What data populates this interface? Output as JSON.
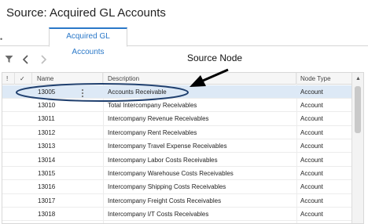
{
  "header": {
    "title": "Source: Acquired GL Accounts"
  },
  "tabs": [
    {
      "label": "Acquired GL Accounts",
      "active": true
    }
  ],
  "toolbar": {
    "icons": [
      "filter-icon",
      "back-arrow-icon",
      "forward-arrow-icon"
    ]
  },
  "annotation": {
    "label": "Source Node"
  },
  "grid": {
    "columns": [
      "!",
      "✓",
      "Name",
      "Description",
      "Node Type"
    ],
    "rows": [
      {
        "name": "13005",
        "description": "Accounts Receivable",
        "node_type": "Account",
        "selected": true
      },
      {
        "name": "13010",
        "description": "Total Intercompany Receivables",
        "node_type": "Account"
      },
      {
        "name": "13011",
        "description": "Intercompany Revenue Receivables",
        "node_type": "Account"
      },
      {
        "name": "13012",
        "description": "Intercompany Rent Receivables",
        "node_type": "Account"
      },
      {
        "name": "13013",
        "description": "Intercompany Travel Expense Receivables",
        "node_type": "Account"
      },
      {
        "name": "13014",
        "description": "Intercompany Labor Costs Receivables",
        "node_type": "Account"
      },
      {
        "name": "13015",
        "description": "Intercompany Warehouse Costs Receivables",
        "node_type": "Account"
      },
      {
        "name": "13016",
        "description": "Intercompany Shipping Costs Receivables",
        "node_type": "Account"
      },
      {
        "name": "13017",
        "description": "Intercompany Freight Costs Receivables",
        "node_type": "Account"
      },
      {
        "name": "13018",
        "description": "Intercompany I/T Costs Receivables",
        "node_type": "Account"
      }
    ]
  },
  "colors": {
    "accent": "#2a78c8",
    "selected_row": "#dde9f6",
    "annotation_ellipse": "#1f3f6e"
  }
}
